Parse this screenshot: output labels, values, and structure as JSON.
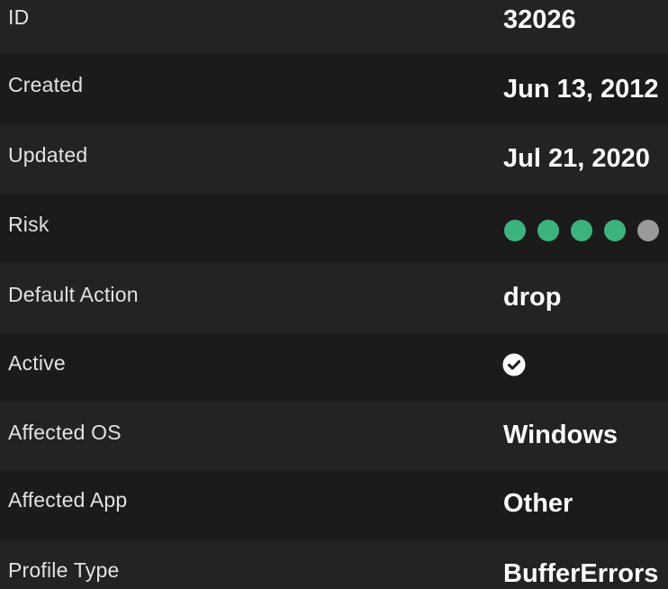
{
  "colors": {
    "row_light": "#232323",
    "row_dark": "#1b1b1b",
    "risk_on": "#3bb37f",
    "risk_off": "#9a9a9a"
  },
  "rows": [
    {
      "label": "ID",
      "value": "32026"
    },
    {
      "label": "Created",
      "value": "Jun 13, 2012"
    },
    {
      "label": "Updated",
      "value": "Jul 21, 2020"
    },
    {
      "label": "Risk",
      "risk": {
        "level": 4,
        "max": 5
      }
    },
    {
      "label": "Default Action",
      "value": "drop"
    },
    {
      "label": "Active",
      "icon": "check-circle-icon"
    },
    {
      "label": "Affected OS",
      "value": "Windows"
    },
    {
      "label": "Affected App",
      "value": "Other"
    },
    {
      "label": "Profile Type",
      "value": "BufferErrors"
    }
  ]
}
